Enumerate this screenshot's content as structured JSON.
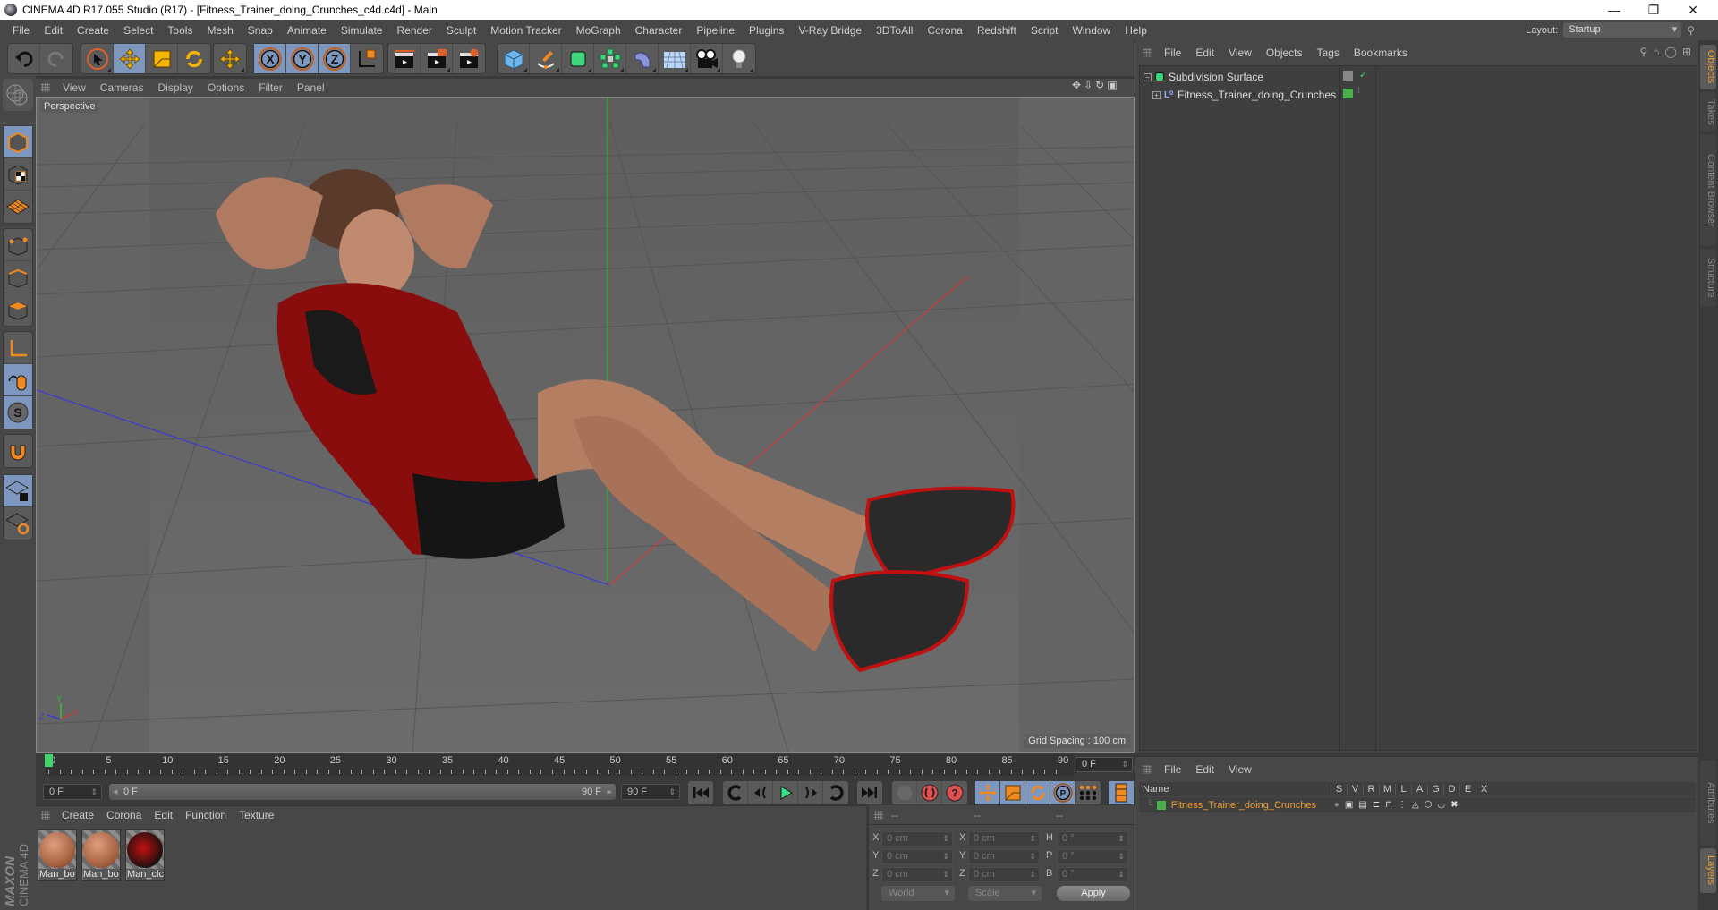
{
  "window": {
    "title": "CINEMA 4D R17.055 Studio (R17) - [Fitness_Trainer_doing_Crunches_c4d.c4d] - Main",
    "controls": [
      "minimize",
      "restore",
      "close"
    ]
  },
  "menubar": [
    "File",
    "Edit",
    "Create",
    "Select",
    "Tools",
    "Mesh",
    "Snap",
    "Animate",
    "Simulate",
    "Render",
    "Sculpt",
    "Motion Tracker",
    "MoGraph",
    "Character",
    "Pipeline",
    "Plugins",
    "V-Ray Bridge",
    "3DToAll",
    "Corona",
    "Redshift",
    "Script",
    "Window",
    "Help"
  ],
  "layout": {
    "label": "Layout:",
    "value": "Startup"
  },
  "toolbar": {
    "history": [
      "undo-icon",
      "redo-icon"
    ],
    "tools": [
      "live-selection-icon",
      "move-icon",
      "scale-icon",
      "rotate-icon"
    ],
    "recent": [
      "move-icon"
    ],
    "axes": [
      "X",
      "Y",
      "Z",
      "coordinate-system-icon"
    ],
    "render": [
      "render-view-icon",
      "render-picture-viewer-icon",
      "edit-render-settings-icon"
    ],
    "objects": [
      "cube-icon",
      "pen-spline-icon",
      "subdivision-surface-icon",
      "cloner-icon",
      "bend-deformer-icon",
      "floor-icon",
      "camera-icon",
      "light-icon"
    ]
  },
  "left_toolbar": [
    "make-editable-icon",
    "model-mode-icon",
    "texture-mode-icon",
    "workplane-icon",
    "points-mode-icon",
    "edges-mode-icon",
    "polygons-mode-icon",
    "axis-icon",
    "tweak-mode-icon",
    "snap-icon",
    "magnet-icon",
    "workplane-lock-icon",
    "planar-workplane-icon"
  ],
  "viewport": {
    "menu": [
      "View",
      "Cameras",
      "Display",
      "Options",
      "Filter",
      "Panel"
    ],
    "camera_label": "Perspective",
    "grid_spacing": "Grid Spacing : 100 cm",
    "axis_labels": {
      "x": "X",
      "y": "Y",
      "z": "Z"
    },
    "colors": {
      "x_axis": "#d03030",
      "y_axis": "#30c030",
      "z_axis": "#3030d0"
    }
  },
  "timeline": {
    "ticks": [
      "0",
      "5",
      "10",
      "15",
      "20",
      "25",
      "30",
      "35",
      "40",
      "45",
      "50",
      "55",
      "60",
      "65",
      "70",
      "75",
      "80",
      "85",
      "90"
    ],
    "current_frame": "0 F",
    "start_field": "0 F",
    "slider_start": "0 F",
    "slider_end": "90 F",
    "end_field": "90 F"
  },
  "playback": [
    "go-to-start-icon",
    "previous-key-icon",
    "previous-frame-icon",
    "play-icon",
    "next-frame-icon",
    "next-key-icon",
    "go-to-end-icon"
  ],
  "keyframe_tools": [
    "motion-record-icon",
    "record-active-icon",
    "auto-key-icon"
  ],
  "key_tracks": [
    "position-track-icon",
    "scale-track-icon",
    "rotation-track-icon",
    "parameter-track-icon",
    "point-level-icon"
  ],
  "timeline_button": "timeline-icon",
  "material_manager": {
    "menu": [
      "Create",
      "Corona",
      "Edit",
      "Function",
      "Texture"
    ],
    "materials": [
      {
        "name": "Man_bo",
        "type": "skin"
      },
      {
        "name": "Man_bo",
        "type": "skin"
      },
      {
        "name": "Man_clc",
        "type": "cloth"
      }
    ]
  },
  "brand": {
    "line1": "MAXON",
    "line2": "CINEMA 4D"
  },
  "coordinates": {
    "header": [
      "--",
      "--",
      "--"
    ],
    "rows": [
      {
        "l1": "X",
        "v1": "0 cm",
        "l2": "X",
        "v2": "0 cm",
        "l3": "H",
        "v3": "0 °"
      },
      {
        "l1": "Y",
        "v1": "0 cm",
        "l2": "Y",
        "v2": "0 cm",
        "l3": "P",
        "v3": "0 °"
      },
      {
        "l1": "Z",
        "v1": "0 cm",
        "l2": "Z",
        "v2": "0 cm",
        "l3": "B",
        "v3": "0 °"
      }
    ],
    "mode": "World",
    "transform": "Scale",
    "apply": "Apply"
  },
  "object_manager": {
    "menu": [
      "File",
      "Edit",
      "View",
      "Objects",
      "Tags",
      "Bookmarks"
    ],
    "objects": [
      {
        "name": "Subdivision Surface",
        "expand": "−",
        "icon": "subdivision-surface-icon"
      },
      {
        "name": "Fitness_Trainer_doing_Crunches",
        "expand": "+",
        "icon": "null-object-icon"
      }
    ]
  },
  "side_tabs_top": [
    {
      "label": "Objects",
      "active": true
    },
    {
      "label": "Takes",
      "active": false
    },
    {
      "label": "Content Browser",
      "active": false
    },
    {
      "label": "Structure",
      "active": false
    }
  ],
  "side_tabs_bottom": [
    {
      "label": "Attributes",
      "active": false
    },
    {
      "label": "Layers",
      "active": true
    }
  ],
  "layer_manager": {
    "menu": [
      "File",
      "Edit",
      "View"
    ],
    "columns": [
      "Name",
      "S",
      "V",
      "R",
      "M",
      "L",
      "A",
      "G",
      "D",
      "E",
      "X"
    ],
    "layers": [
      {
        "name": "Fitness_Trainer_doing_Crunches",
        "color": "#4ab04a"
      }
    ]
  },
  "accent_colors": {
    "active_tab": "#f0a030",
    "layer_name": "#f0a030",
    "selected_tool": "#7d97bf",
    "current_frame": "#3fd66b"
  }
}
